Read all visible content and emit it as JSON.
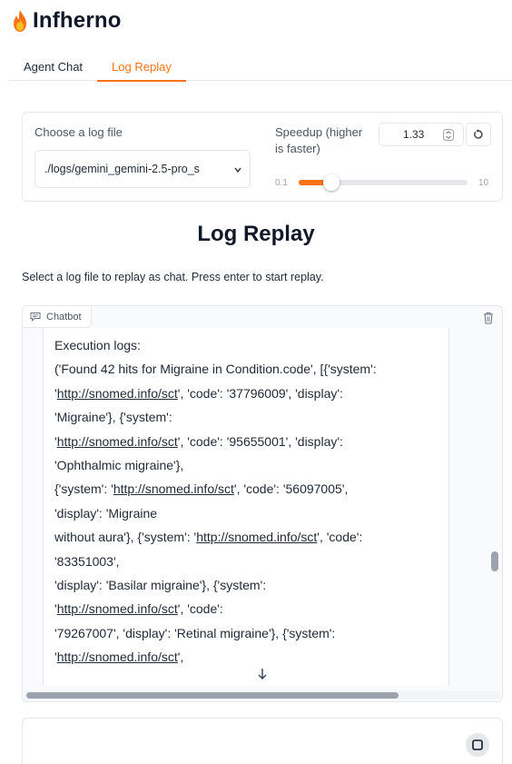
{
  "app": {
    "title": "Infherno",
    "logo_icon": "fire-emoji"
  },
  "tabs": [
    {
      "label": "Agent Chat",
      "active": false
    },
    {
      "label": "Log Replay",
      "active": true
    }
  ],
  "controls": {
    "log_file_label": "Choose a log file",
    "log_file_value": "./logs/gemini_gemini-2.5-pro_s",
    "speed_label_line1": "Speedup (higher",
    "speed_label_line2": "is faster)",
    "speed_value": "1.33",
    "slider_min": "0.1",
    "slider_max": "10",
    "slider_value": 1.33
  },
  "replay": {
    "heading": "Log Replay",
    "description": "Select a log file to replay as chat. Press enter to start replay."
  },
  "chatbot": {
    "label": "Chatbot",
    "lines": [
      [
        {
          "t": "Execution logs:"
        }
      ],
      [
        {
          "t": "('Found 42 hits for Migraine in Condition.code', [{'system':"
        }
      ],
      [
        {
          "t": "'"
        },
        {
          "t": "http://snomed.info/sct",
          "link": true
        },
        {
          "t": "', 'code': '37796009', 'display':"
        }
      ],
      [
        {
          "t": "'Migraine'}, {'system':"
        }
      ],
      [
        {
          "t": "'"
        },
        {
          "t": "http://snomed.info/sct",
          "link": true
        },
        {
          "t": "', 'code': '95655001', 'display':"
        }
      ],
      [
        {
          "t": "'Ophthalmic migraine'},"
        }
      ],
      [
        {
          "t": "{'system': '"
        },
        {
          "t": "http://snomed.info/sct",
          "link": true
        },
        {
          "t": "', 'code': '56097005',"
        }
      ],
      [
        {
          "t": "'display': 'Migraine"
        }
      ],
      [
        {
          "t": "without aura'}, {'system': '"
        },
        {
          "t": "http://snomed.info/sct",
          "link": true
        },
        {
          "t": "', 'code':"
        }
      ],
      [
        {
          "t": "'83351003',"
        }
      ],
      [
        {
          "t": "'display': 'Basilar migraine'}, {'system':"
        }
      ],
      [
        {
          "t": "'"
        },
        {
          "t": "http://snomed.info/sct",
          "link": true
        },
        {
          "t": "', 'code':"
        }
      ],
      [
        {
          "t": "'79267007', 'display': 'Retinal migraine'}, {'system':"
        }
      ],
      [
        {
          "t": "'"
        },
        {
          "t": "http://snomed.info/sct",
          "link": true
        },
        {
          "t": "',"
        }
      ]
    ]
  },
  "colors": {
    "accent": "#f97316",
    "border": "#e5e7eb",
    "text": "#1f2937"
  }
}
